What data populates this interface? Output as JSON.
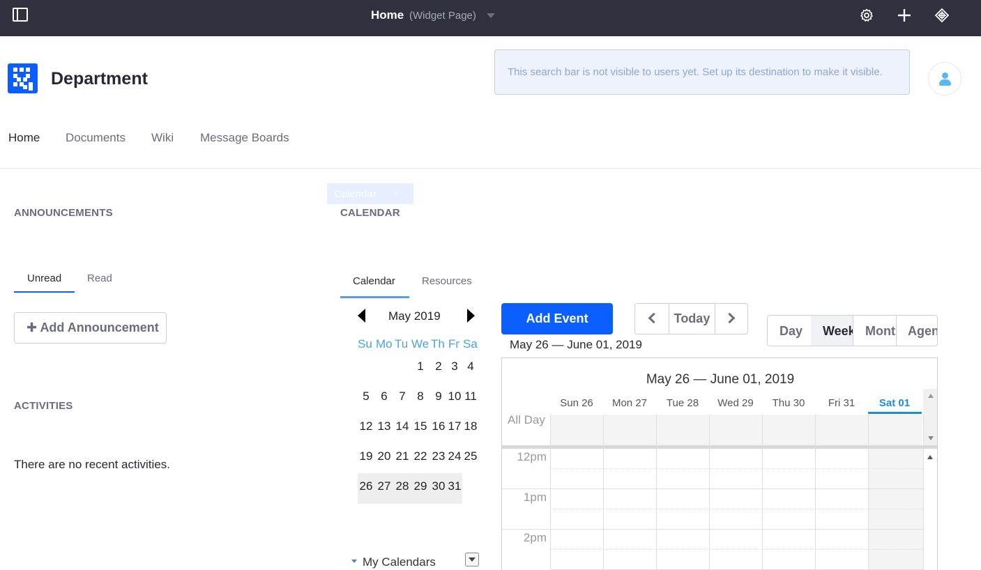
{
  "topbar": {
    "title": "Home",
    "page_type": "(Widget Page)",
    "icons": [
      "sidebar-toggle-icon",
      "gear-icon",
      "plus-icon",
      "simulation-icon"
    ]
  },
  "header": {
    "site_name": "Department",
    "search_notice": "This search bar is not visible to users yet. Set up its destination to make it visible."
  },
  "nav": {
    "items": [
      "Home",
      "Documents",
      "Wiki",
      "Message Boards"
    ],
    "active": "Home"
  },
  "announcements": {
    "title": "ANNOUNCEMENTS",
    "tabs": [
      "Unread",
      "Read"
    ],
    "add_button": "Add Announcement"
  },
  "activities": {
    "title": "ACTIVITIES",
    "empty_text": "There are no recent activities."
  },
  "calendar": {
    "portlet_tag": "Calendar",
    "title": "CALENDAR",
    "tabs": [
      "Calendar",
      "Resources"
    ],
    "mini": {
      "month_label": "May 2019",
      "weekdays": [
        "Su",
        "Mo",
        "Tu",
        "We",
        "Th",
        "Fr",
        "Sa"
      ],
      "weeks": [
        [
          "",
          "",
          "",
          "1",
          "2",
          "3",
          "4"
        ],
        [
          "5",
          "6",
          "7",
          "8",
          "9",
          "10",
          "11"
        ],
        [
          "12",
          "13",
          "14",
          "15",
          "16",
          "17",
          "18"
        ],
        [
          "19",
          "20",
          "21",
          "22",
          "23",
          "24",
          "25"
        ],
        [
          "26",
          "27",
          "28",
          "29",
          "30",
          "31",
          ""
        ]
      ]
    },
    "my_calendars": "My Calendars"
  },
  "scheduler": {
    "add_event": "Add Event",
    "today": "Today",
    "range_label": "May 26 — June 01, 2019",
    "views": [
      "Day",
      "Week",
      "Mont",
      "Agen"
    ],
    "active_view": "Week",
    "grid_title": "May 26 — June 01, 2019",
    "days": [
      "Sun 26",
      "Mon 27",
      "Tue 28",
      "Wed 29",
      "Thu 30",
      "Fri 31",
      "Sat 01"
    ],
    "today_day": "Sat 01",
    "all_day_label": "All Day",
    "times": [
      "12pm",
      "1pm",
      "2pm"
    ]
  },
  "colors": {
    "topbar": "#30313f",
    "primary": "#0b5fff",
    "today_accent": "#1a8fd8",
    "weekday_text": "#4aa3df"
  }
}
